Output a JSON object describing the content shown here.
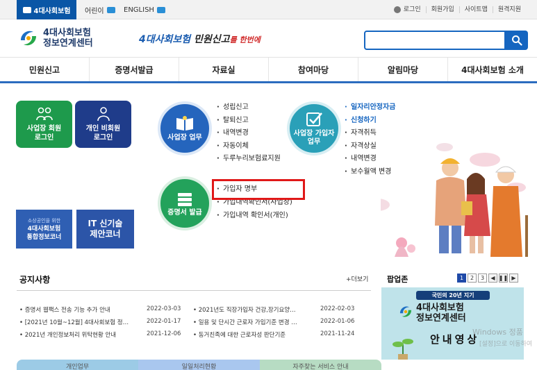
{
  "topbar": {
    "tabs": [
      {
        "label": "4대사회보험",
        "active": true
      },
      {
        "label": "어린이"
      },
      {
        "label": "ENGLISH"
      }
    ],
    "util": [
      "로그인",
      "회원가입",
      "사이트맵",
      "원격지원"
    ]
  },
  "header": {
    "logo_line1": "4대사회보험",
    "logo_line2": "정보연계센터",
    "slogan_main": "4대사회보험",
    "slogan_mid": "민원신고",
    "slogan_end": "를 한번에"
  },
  "nav": [
    "민원신고",
    "증명서발급",
    "자료실",
    "참여마당",
    "알림마당",
    "4대사회보험 소개"
  ],
  "tiles": {
    "workplace_line1": "사업장 회원",
    "workplace_line2": "로그인",
    "personal_line1": "개인 비회원",
    "personal_line2": "로그인"
  },
  "promos": {
    "a_small": "소상공인을 위한",
    "a_line1": "4대사회보험",
    "a_line2": "통합정보코너",
    "b_line1": "IT 신기술",
    "b_line2": "제안코너"
  },
  "circles": {
    "business": "사업장 업무",
    "member_line1": "사업장 가입자",
    "member_line2": "업무",
    "cert": "증명서 발급"
  },
  "business_items": [
    "성립신고",
    "탈퇴신고",
    "내역변경",
    "자동이체",
    "두루누리보험료지원"
  ],
  "member_items": [
    "일자리안정자금",
    "신청하기",
    "자격취득",
    "자격상실",
    "내역변경",
    "보수월액 변경"
  ],
  "cert_items": [
    "가입자 명부",
    "가입내역확인서(사업장)",
    "가입내역 확인서(개인)"
  ],
  "notice": {
    "title": "공지사항",
    "more": "+더보기",
    "rows": [
      [
        {
          "title": "증명서 웹팩스 전송 기능 추가 안내",
          "date": "2022-03-03"
        },
        {
          "title": "2021년도 직장가입자 건강,장기요양…",
          "date": "2022-02-03"
        }
      ],
      [
        {
          "title": "[2021년 10월~12월] 4대사회보험 정…",
          "date": "2022-01-17"
        },
        {
          "title": "일용 및 단시간 근로자 가입기준 변경 …",
          "date": "2022-01-06"
        }
      ],
      [
        {
          "title": "2021년 개인정보처리 위탁현황 안내",
          "date": "2021-12-06"
        },
        {
          "title": "동거친족에 대한 근로자성 판단기준",
          "date": "2021-11-24"
        }
      ]
    ]
  },
  "popup": {
    "title": "팝업존",
    "pages": [
      "1",
      "2",
      "3"
    ],
    "head": "국민의 20년 지기",
    "org_line1": "4대사회보험",
    "org_line2": "정보연계센터",
    "video": "안내영상"
  },
  "watermark": {
    "line1": "Windows 정품",
    "line2": "[설정]으로 이동하여"
  },
  "bottom": [
    "개인업무",
    "일일처리현황",
    "자주찾는 서비스 안내"
  ],
  "colors": {
    "primary": "#1565c0",
    "green": "#1e9a4c",
    "navy": "#1f3c8a",
    "highlight": "#e01818"
  }
}
